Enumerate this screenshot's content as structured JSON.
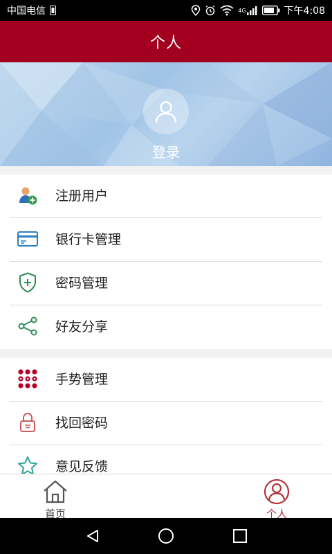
{
  "status_bar": {
    "carrier": "中国电信",
    "network": "4G",
    "time": "下午4:08"
  },
  "header": {
    "title": "个人"
  },
  "profile": {
    "login_label": "登录"
  },
  "menu_group_1": [
    {
      "label": "注册用户",
      "icon": "add-user-icon"
    },
    {
      "label": "银行卡管理",
      "icon": "bank-card-icon"
    },
    {
      "label": "密码管理",
      "icon": "shield-icon"
    },
    {
      "label": "好友分享",
      "icon": "share-icon"
    }
  ],
  "menu_group_2": [
    {
      "label": "手势管理",
      "icon": "gesture-grid-icon"
    },
    {
      "label": "找回密码",
      "icon": "lock-icon"
    },
    {
      "label": "意见反馈",
      "icon": "star-icon"
    }
  ],
  "tabbar": {
    "home_label": "首页",
    "profile_label": "个人"
  },
  "colors": {
    "header": "#a3001f",
    "active_tab": "#b3353d",
    "accent_green": "#2e8b57"
  }
}
